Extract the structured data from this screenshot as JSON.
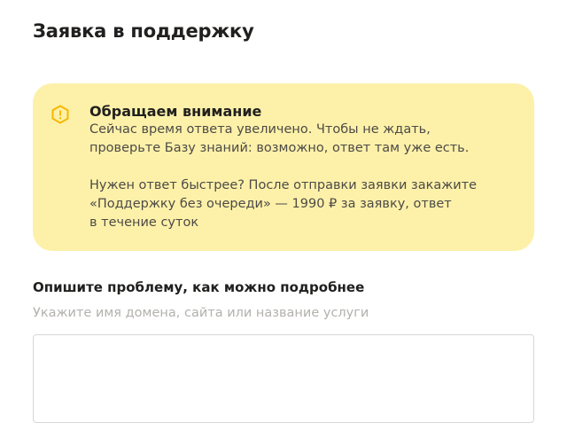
{
  "page": {
    "title": "Заявка в поддержку"
  },
  "notice": {
    "icon": "warning-hexagon-icon",
    "icon_color": "#f5b800",
    "background_color": "#fdf1a9",
    "title": "Обращаем внимание",
    "paragraph1_lines": [
      "Сейчас время ответа увеличено. Чтобы не ждать,",
      "проверьте Базу знаний: возможно, ответ там уже есть."
    ],
    "paragraph2_lines": [
      "Нужен ответ быстрее? После отправки заявки закажите",
      "«Поддержку без очереди» — 1990 ₽ за заявку, ответ",
      "в течение суток"
    ]
  },
  "form": {
    "problem_label": "Опишите проблему, как можно подробнее",
    "problem_hint": "Укажите имя домена, сайта или название услуги",
    "problem_value": ""
  }
}
